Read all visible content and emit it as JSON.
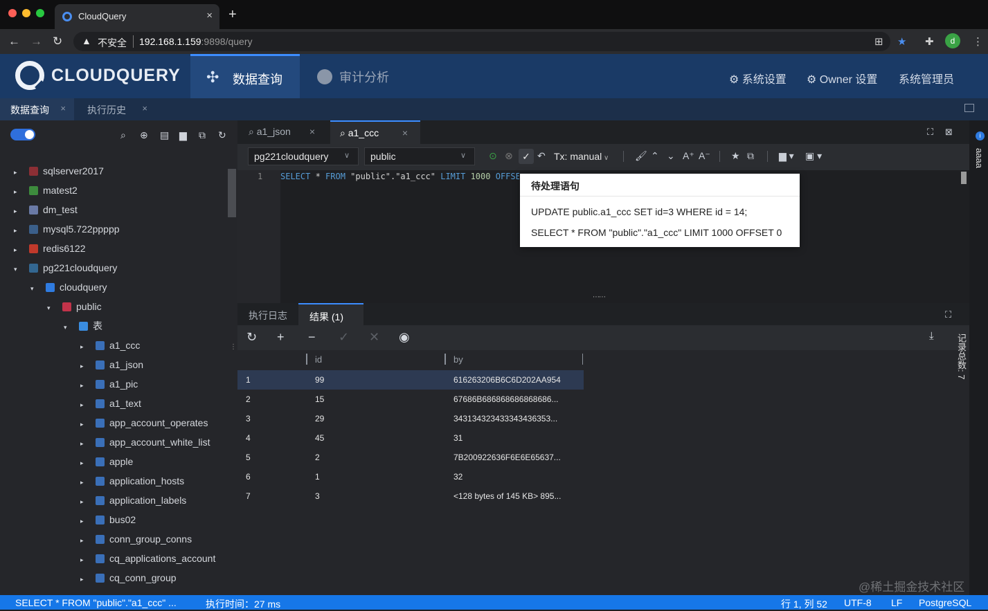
{
  "browser": {
    "tab_title": "CloudQuery",
    "tab_close": "×",
    "new_tab": "+",
    "insecure_label": "不安全",
    "url_host": "192.168.1.159",
    "url_rest": ":9898/query",
    "avatar_letter": "d"
  },
  "header": {
    "logo_text": "CLOUDQUERY",
    "nav_query": "数据查询",
    "nav_audit": "审计分析",
    "system_settings": "系统设置",
    "owner_settings": "Owner 设置",
    "system_admin": "系统管理员"
  },
  "doc_tabs": [
    {
      "label": "数据查询",
      "close": "×"
    },
    {
      "label": "执行历史",
      "close": "×"
    }
  ],
  "tree": [
    {
      "label": "sqlserver2017",
      "indent": 0,
      "arrow": "▸",
      "color": "#8c2f35"
    },
    {
      "label": "matest2",
      "indent": 0,
      "arrow": "▸",
      "color": "#3d8b3d"
    },
    {
      "label": "dm_test",
      "indent": 0,
      "arrow": "▸",
      "color": "#6a7aa6"
    },
    {
      "label": "mysql5.722ppppp",
      "indent": 0,
      "arrow": "▸",
      "color": "#3b5f8a"
    },
    {
      "label": "redis6122",
      "indent": 0,
      "arrow": "▸",
      "color": "#c0392b"
    },
    {
      "label": "pg221cloudquery",
      "indent": 0,
      "arrow": "▾",
      "color": "#336791"
    },
    {
      "label": "cloudquery",
      "indent": 1,
      "arrow": "▾",
      "color": "#2f7be0"
    },
    {
      "label": "public",
      "indent": 2,
      "arrow": "▾",
      "color": "#c2334a"
    },
    {
      "label": "表",
      "indent": 3,
      "arrow": "▾",
      "color": "#3a8de0"
    },
    {
      "label": "a1_ccc",
      "indent": 4,
      "arrow": "▸",
      "color": "#3a6fb8"
    },
    {
      "label": "a1_json",
      "indent": 4,
      "arrow": "▸",
      "color": "#3a6fb8"
    },
    {
      "label": "a1_pic",
      "indent": 4,
      "arrow": "▸",
      "color": "#3a6fb8"
    },
    {
      "label": "a1_text",
      "indent": 4,
      "arrow": "▸",
      "color": "#3a6fb8"
    },
    {
      "label": "app_account_operates",
      "indent": 4,
      "arrow": "▸",
      "color": "#3a6fb8"
    },
    {
      "label": "app_account_white_list",
      "indent": 4,
      "arrow": "▸",
      "color": "#3a6fb8"
    },
    {
      "label": "apple",
      "indent": 4,
      "arrow": "▸",
      "color": "#3a6fb8"
    },
    {
      "label": "application_hosts",
      "indent": 4,
      "arrow": "▸",
      "color": "#3a6fb8"
    },
    {
      "label": "application_labels",
      "indent": 4,
      "arrow": "▸",
      "color": "#3a6fb8"
    },
    {
      "label": "bus02",
      "indent": 4,
      "arrow": "▸",
      "color": "#3a6fb8"
    },
    {
      "label": "conn_group_conns",
      "indent": 4,
      "arrow": "▸",
      "color": "#3a6fb8"
    },
    {
      "label": "cq_applications_account",
      "indent": 4,
      "arrow": "▸",
      "color": "#3a6fb8"
    },
    {
      "label": "cq_conn_group",
      "indent": 4,
      "arrow": "▸",
      "color": "#3a6fb8"
    }
  ],
  "editor_tabs": [
    {
      "label": "a1_json",
      "close": "×"
    },
    {
      "label": "a1_ccc",
      "close": "×"
    }
  ],
  "toolbar": {
    "connection": "pg221cloudquery",
    "schema": "public",
    "tx_mode": "Tx: manual"
  },
  "editor": {
    "line_number": "1",
    "code_kw1": "SELECT",
    "code_star": " * ",
    "code_kw2": "FROM",
    "code_table": " \"public\".\"a1_ccc\" ",
    "code_kw3": "LIMIT",
    "code_num": " 1000 ",
    "code_kw4": "OFFSET"
  },
  "pending_popup": {
    "title": "待处理语句",
    "statements": [
      "UPDATE public.a1_ccc SET id=3 WHERE id = 14;",
      "SELECT * FROM \"public\".\"a1_ccc\" LIMIT 1000 OFFSET 0"
    ]
  },
  "result_tabs": [
    {
      "label": "执行日志"
    },
    {
      "label": "结果  (1)"
    }
  ],
  "grid": {
    "columns": [
      "id",
      "by"
    ],
    "rows": [
      [
        "1",
        "99",
        "616263206B6C6D202AA954"
      ],
      [
        "2",
        "15",
        "67686B686868686868686..."
      ],
      [
        "3",
        "29",
        "343134323433343436353..."
      ],
      [
        "4",
        "45",
        "31"
      ],
      [
        "5",
        "2",
        "7B200922636F6E6E65637..."
      ],
      [
        "6",
        "1",
        "32"
      ],
      [
        "7",
        "3",
        "<128 bytes of 145 KB> 895..."
      ]
    ]
  },
  "right_side": {
    "info_badge": "i",
    "label": "aaaa",
    "record_count": "记录总数: 7"
  },
  "watermark": "@稀土掘金技术社区",
  "status_bar": {
    "query": "SELECT * FROM \"public\".\"a1_ccc\" ...",
    "exec_time": "执行时间：27 ms",
    "position": "行 1, 列 52",
    "encoding": "UTF-8",
    "eol": "LF",
    "language": "PostgreSQL"
  }
}
